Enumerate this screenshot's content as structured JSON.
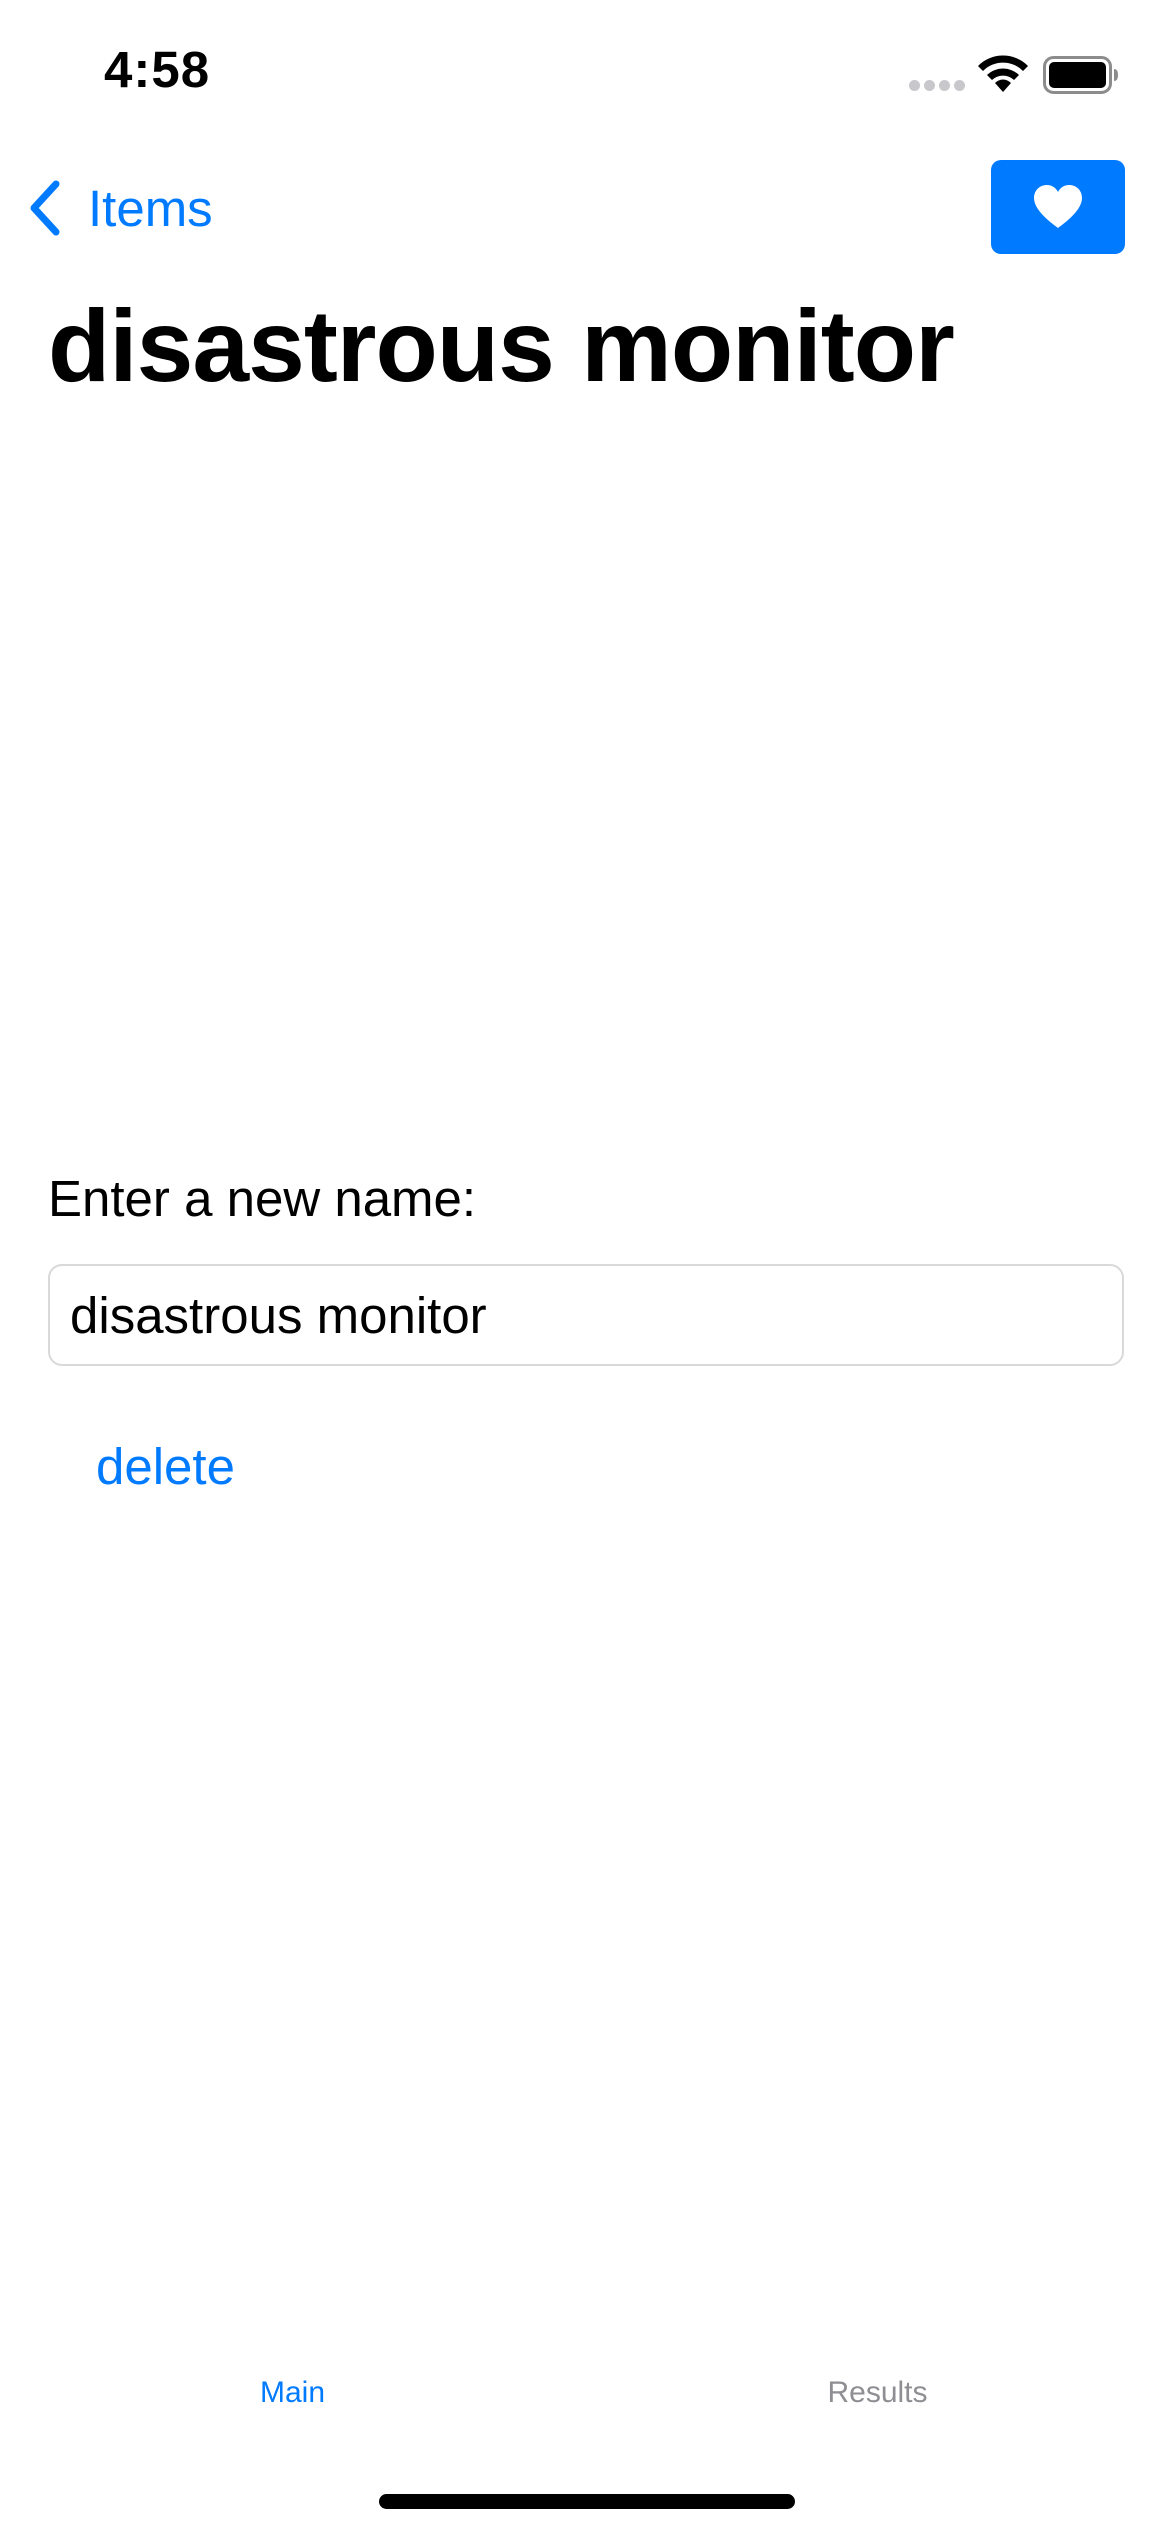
{
  "status_bar": {
    "time": "4:58"
  },
  "nav": {
    "back_label": "Items",
    "back_icon": "chevron-left-icon",
    "favorite_icon": "heart-icon"
  },
  "title": "disastrous monitor",
  "form": {
    "label": "Enter a new name:",
    "name_value": "disastrous monitor",
    "delete_label": "delete"
  },
  "tabs": [
    {
      "label": "Main",
      "selected": true
    },
    {
      "label": "Results",
      "selected": false
    }
  ],
  "colors": {
    "accent": "#007aff",
    "inactive_tab": "#8e8e93"
  }
}
